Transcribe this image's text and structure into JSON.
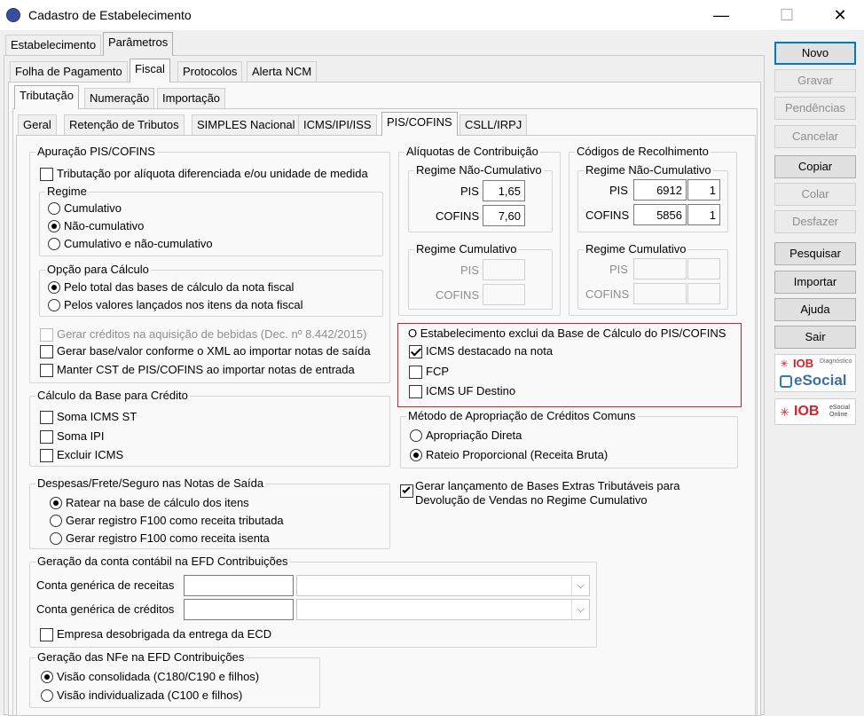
{
  "window": {
    "title": "Cadastro de Estabelecimento",
    "minimize": "—",
    "maximize": "☐",
    "close": "✕"
  },
  "tabs1": [
    "Estabelecimento",
    "Parâmetros"
  ],
  "tabs2": [
    "Folha de Pagamento",
    "Fiscal",
    "Protocolos",
    "Alerta NCM"
  ],
  "tabs3": [
    "Tributação",
    "Numeração",
    "Importação"
  ],
  "tabs4": [
    "Geral",
    "Retenção de Tributos",
    "SIMPLES Nacional",
    "ICMS/IPI/ISS",
    "PIS/COFINS",
    "CSLL/IRPJ"
  ],
  "apuracao": {
    "title": "Apuração PIS/COFINS",
    "trib_aliquota": "Tributação por alíquota diferenciada e/ou unidade de medida",
    "regime": {
      "title": "Regime",
      "opt1": "Cumulativo",
      "opt2": "Não-cumulativo",
      "opt3": "Cumulativo e não-cumulativo"
    },
    "opcao": {
      "title": "Opção para Cálculo",
      "opt1": "Pelo total das bases de cálculo da nota fiscal",
      "opt2": "Pelos valores lançados nos itens da nota fiscal"
    },
    "gerar_creditos": "Gerar créditos na aquisição de bebidas (Dec. nº 8.442/2015)",
    "gerar_base": "Gerar base/valor conforme o XML ao importar notas de saída",
    "manter_cst": "Manter CST de PIS/COFINS ao importar notas de entrada"
  },
  "aliquotas": {
    "title": "Alíquotas de Contribuição",
    "nc_title": "Regime Não-Cumulativo",
    "pis_label": "PIS",
    "cofins_label": "COFINS",
    "pis": "1,65",
    "cofins": "7,60",
    "c_title": "Regime Cumulativo",
    "c_pis_label": "PIS",
    "c_cofins_label": "COFINS"
  },
  "codigos": {
    "title": "Códigos de Recolhimento",
    "nc_title": "Regime Não-Cumulativo",
    "pis_label": "PIS",
    "cofins_label": "COFINS",
    "pis_code": "6912",
    "pis_var": "1",
    "cofins_code": "5856",
    "cofins_var": "1",
    "c_title": "Regime Cumulativo",
    "c_pis_label": "PIS",
    "c_cofins_label": "COFINS"
  },
  "exclui": {
    "title": "O Estabelecimento exclui da Base de Cálculo do PIS/COFINS",
    "icms": "ICMS destacado na nota",
    "fcp": "FCP",
    "icms_uf": "ICMS UF Destino"
  },
  "metodo": {
    "title": "Método de Apropriação de Créditos Comuns",
    "opt1": "Apropriação Direta",
    "opt2": "Rateio Proporcional (Receita Bruta)"
  },
  "calculo": {
    "title": "Cálculo da Base para Crédito",
    "opt1": "Soma ICMS ST",
    "opt2": "Soma IPI",
    "opt3": "Excluir ICMS"
  },
  "gerar_lanc": {
    "line1": "Gerar lançamento de Bases Extras Tributáveis para",
    "line2": "Devolução de Vendas no Regime Cumulativo"
  },
  "despesas": {
    "title": "Despesas/Frete/Seguro nas Notas de Saída",
    "opt1": "Ratear na base de cálculo dos itens",
    "opt2": "Gerar registro F100 como receita tributada",
    "opt3": "Gerar registro F100 como receita isenta"
  },
  "conta": {
    "title": "Geração da conta contábil na EFD Contribuições",
    "receitas": "Conta genérica de receitas",
    "creditos": "Conta genérica de créditos",
    "empresa": "Empresa desobrigada da entrega da ECD"
  },
  "nfe": {
    "title": "Geração das NFe na EFD Contribuições",
    "opt1": "Visão consolidada (C180/C190 e filhos)",
    "opt2": "Visão individualizada (C100 e filhos)"
  },
  "buttons": {
    "novo": "Novo",
    "gravar": "Gravar",
    "pendencias": "Pendências",
    "cancelar": "Cancelar",
    "copiar": "Copiar",
    "colar": "Colar",
    "desfazer": "Desfazer",
    "pesquisar": "Pesquisar",
    "importar": "Importar",
    "ajuda": "Ajuda",
    "sair": "Sair"
  },
  "logos": {
    "iob1": "IOB",
    "iob1_sub": "Diagnóstico",
    "esocial": "eSocial",
    "iob2": "IOB",
    "iob2_sub1": "eSocial",
    "iob2_sub2": "Online"
  }
}
